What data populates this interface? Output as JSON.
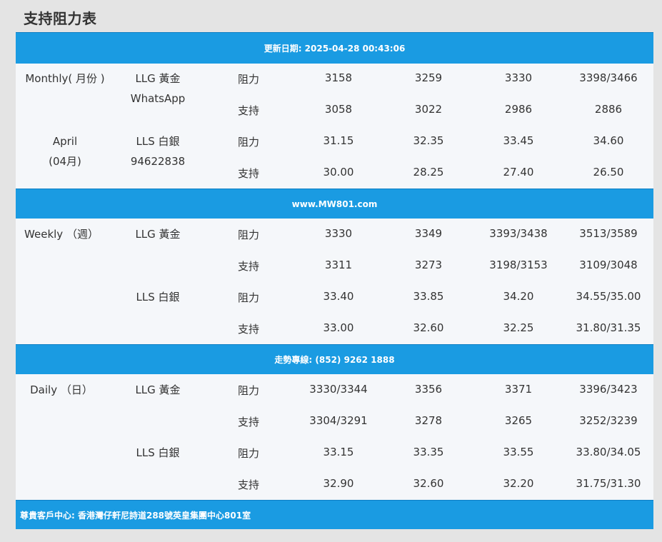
{
  "page": {
    "title": "支持阻力表"
  },
  "bars": {
    "updated": "更新日期: 2025-04-28 00:43:06",
    "website": "www.MW801.com",
    "hotline": "走勢專線: (852) 9262 1888",
    "address": "尊貴客戶中心: 香港灣仔軒尼詩道288號英皇集團中心801室"
  },
  "sections": [
    {
      "period": "Monthly( 月份 )",
      "period2": "April\n(04月)",
      "rows": [
        {
          "metal": "LLG 黃金",
          "type": "阻力",
          "values": [
            "3158",
            "3259",
            "3330",
            "3398/3466"
          ]
        },
        {
          "metal": "",
          "type": "支持",
          "values": [
            "3058",
            "3022",
            "2986",
            "2886"
          ]
        },
        {
          "metal": "LLS 白銀",
          "type": "阻力",
          "values": [
            "31.15",
            "32.35",
            "33.45",
            "34.60"
          ]
        },
        {
          "metal": "",
          "type": "支持",
          "values": [
            "30.00",
            "28.25",
            "27.40",
            "26.50"
          ]
        }
      ],
      "whatsapp_label": "WhatsApp",
      "whatsapp_number": "94622838"
    },
    {
      "period": "Weekly （週）",
      "rows": [
        {
          "metal": "LLG 黃金",
          "type": "阻力",
          "values": [
            "3330",
            "3349",
            "3393/3438",
            "3513/3589"
          ]
        },
        {
          "metal": "",
          "type": "支持",
          "values": [
            "3311",
            "3273",
            "3198/3153",
            "3109/3048"
          ]
        },
        {
          "metal": "LLS 白銀",
          "type": "阻力",
          "values": [
            "33.40",
            "33.85",
            "34.20",
            "34.55/35.00"
          ]
        },
        {
          "metal": "",
          "type": "支持",
          "values": [
            "33.00",
            "32.60",
            "32.25",
            "31.80/31.35"
          ]
        }
      ]
    },
    {
      "period": "Daily （日）",
      "rows": [
        {
          "metal": "LLG 黃金",
          "type": "阻力",
          "values": [
            "3330/3344",
            "3356",
            "3371",
            "3396/3423"
          ]
        },
        {
          "metal": "",
          "type": "支持",
          "values": [
            "3304/3291",
            "3278",
            "3265",
            "3252/3239"
          ]
        },
        {
          "metal": "LLS 白銀",
          "type": "阻力",
          "values": [
            "33.15",
            "33.35",
            "33.55",
            "33.80/34.05"
          ]
        },
        {
          "metal": "",
          "type": "支持",
          "values": [
            "32.90",
            "32.60",
            "32.20",
            "31.75/31.30"
          ]
        }
      ]
    }
  ],
  "colors": {
    "bar": "#1a9be2",
    "panel": "#f5f7fa",
    "text": "#333333"
  }
}
